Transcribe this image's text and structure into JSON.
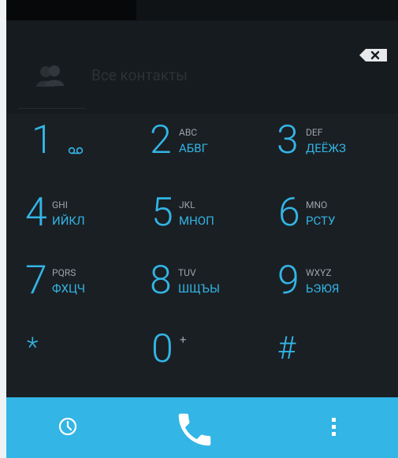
{
  "header": {
    "contacts_label": "Все контакты"
  },
  "keys": [
    {
      "digit": "1",
      "latin": "",
      "cyrillic": ""
    },
    {
      "digit": "2",
      "latin": "ABC",
      "cyrillic": "АБВГ"
    },
    {
      "digit": "3",
      "latin": "DEF",
      "cyrillic": "ДЕЁЖЗ"
    },
    {
      "digit": "4",
      "latin": "GHI",
      "cyrillic": "ИЙКЛ"
    },
    {
      "digit": "5",
      "latin": "JKL",
      "cyrillic": "МНОП"
    },
    {
      "digit": "6",
      "latin": "MNO",
      "cyrillic": "РСТУ"
    },
    {
      "digit": "7",
      "latin": "PQRS",
      "cyrillic": "ФХЦЧ"
    },
    {
      "digit": "8",
      "latin": "TUV",
      "cyrillic": "ШЩЪЫ"
    },
    {
      "digit": "9",
      "latin": "WXYZ",
      "cyrillic": "ЬЭЮЯ"
    },
    {
      "digit": "*",
      "latin": "",
      "cyrillic": ""
    },
    {
      "digit": "0",
      "latin": "+",
      "cyrillic": ""
    },
    {
      "digit": "#",
      "latin": "",
      "cyrillic": ""
    }
  ],
  "icons": {
    "backspace": "backspace-icon",
    "contacts": "contacts-icon",
    "voicemail": "voicemail-icon",
    "history": "history-icon",
    "call": "phone-icon",
    "menu": "overflow-menu-icon"
  },
  "colors": {
    "accent": "#33b5e5",
    "background": "#1a1f24",
    "header": "#161b1f",
    "bar": "#33b5e5"
  }
}
